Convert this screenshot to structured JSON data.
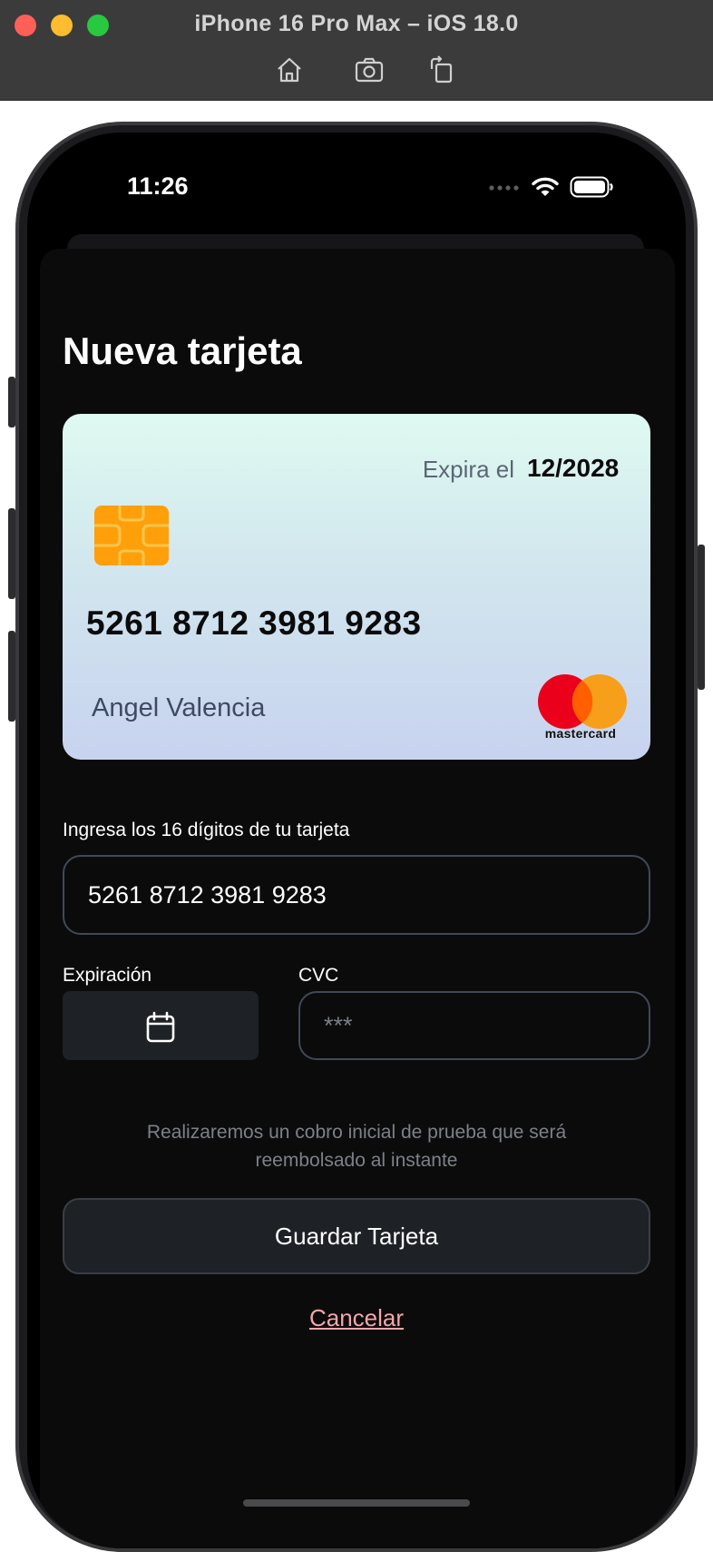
{
  "window": {
    "title": "iPhone 16 Pro Max – iOS 18.0",
    "toolbar": [
      "home-icon",
      "screenshot-icon",
      "rotate-icon"
    ]
  },
  "status_bar": {
    "time": "11:26",
    "icons": [
      "signal-icon",
      "wifi-icon",
      "battery-icon"
    ]
  },
  "screen": {
    "title": "Nueva tarjeta",
    "card": {
      "expiry_label": "Expira el",
      "expiry_value": "12/2028",
      "number": "5261 8712 3981 9283",
      "holder": "Angel Valencia",
      "brand": "mastercard"
    },
    "form": {
      "card_number_label": "Ingresa los 16 dígitos de tu tarjeta",
      "card_number_value": "5261 8712 3981 9283",
      "expiry_label": "Expiración",
      "cvc_label": "CVC",
      "cvc_placeholder": "***"
    },
    "note": "Realizaremos un cobro inicial de prueba que será reembolsado al instante",
    "save_button": "Guardar Tarjeta",
    "cancel_link": "Cancelar"
  },
  "colors": {
    "background": "#0b0b0c",
    "accent_cancel": "#f4a6a9",
    "chip": "#ff9f0a",
    "mc_red": "#eb001b",
    "mc_orange": "#f79e1b"
  }
}
